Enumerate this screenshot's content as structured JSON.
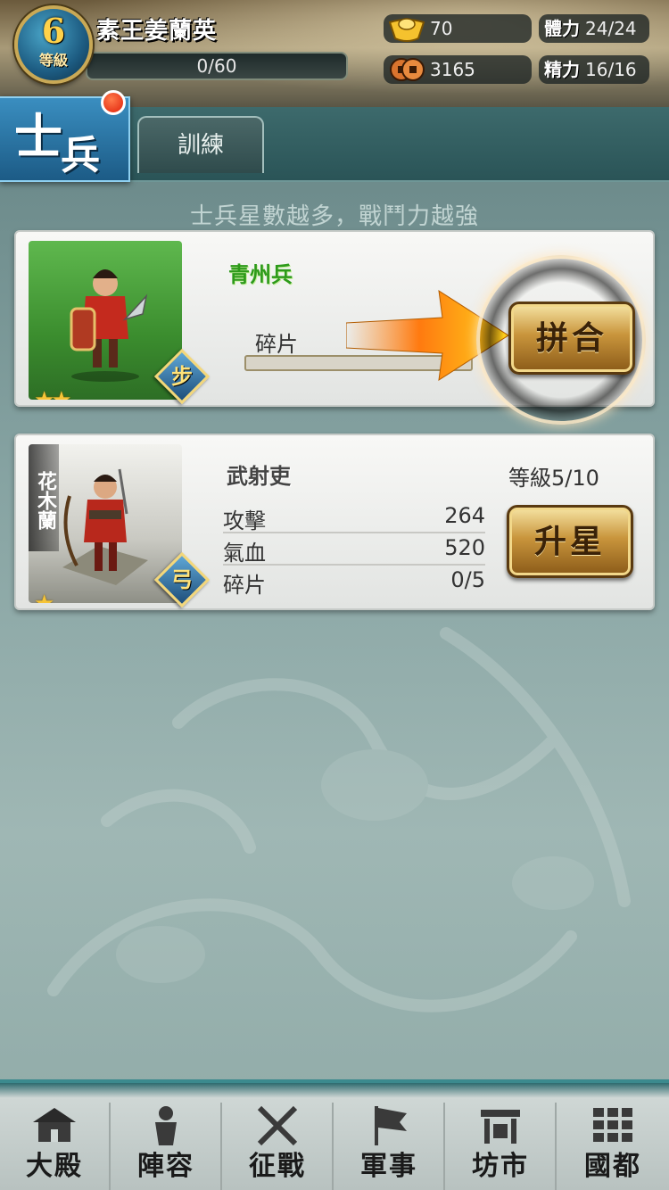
{
  "player": {
    "level": "6",
    "level_label": "等級",
    "name": "素王姜蘭英",
    "exp": "0/60"
  },
  "resources": {
    "gold": "70",
    "coins": "3165",
    "stamina_label": "體力",
    "stamina": "24/24",
    "energy_label": "精力",
    "energy": "16/16"
  },
  "section": {
    "title_char1": "士",
    "title_char2": "兵",
    "tab_label": "訓練",
    "hint": "士兵星數越多，戰鬥力越強"
  },
  "units": [
    {
      "name": "青州兵",
      "class_label": "步",
      "stars": "★★",
      "fragments_label": "碎片",
      "fragments_progress": 0,
      "action_label": "拼合"
    },
    {
      "name": "武射吏",
      "portrait_name": "花木蘭",
      "class_label": "弓",
      "stars": "★",
      "level_text": "等級5/10",
      "stats": [
        {
          "label": "攻擊",
          "value": "264"
        },
        {
          "label": "氣血",
          "value": "520"
        },
        {
          "label": "碎片",
          "value": "0/5"
        }
      ],
      "action_label": "升星"
    }
  ],
  "nav": [
    {
      "label": "大殿",
      "icon": "palace-icon"
    },
    {
      "label": "陣容",
      "icon": "warrior-icon"
    },
    {
      "label": "征戰",
      "icon": "crossed-swords-icon"
    },
    {
      "label": "軍事",
      "icon": "war-flag-icon"
    },
    {
      "label": "坊市",
      "icon": "market-icon"
    },
    {
      "label": "國都",
      "icon": "city-grid-icon"
    }
  ],
  "colors": {
    "accent_gold": "#c9953c",
    "unit_name_green": "#2d9a1a",
    "nav_border": "#3b8a8e"
  }
}
